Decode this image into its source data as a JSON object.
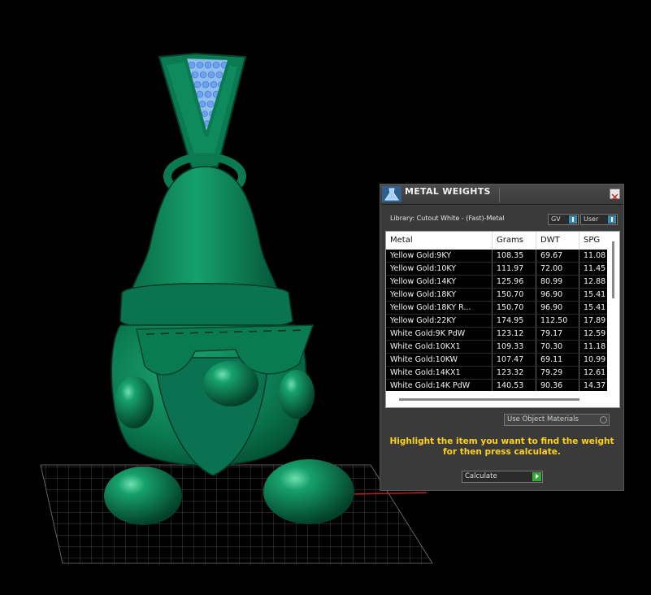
{
  "panel": {
    "title": "METAL WEIGHTS",
    "library": "Library: Cutout White - (Fast)-Metal",
    "gv_label": "GV",
    "user_label": "User",
    "columns": [
      "Metal",
      "Grams",
      "DWT",
      "SPG"
    ],
    "rows": [
      [
        "Yellow Gold:9KY",
        "108.35",
        "69.67",
        "11.08"
      ],
      [
        "Yellow Gold:10KY",
        "111.97",
        "72.00",
        "11.45"
      ],
      [
        "Yellow Gold:14KY",
        "125.96",
        "80.99",
        "12.88"
      ],
      [
        "Yellow Gold:18KY",
        "150.70",
        "96.90",
        "15.41"
      ],
      [
        "Yellow Gold:18KY R...",
        "150.70",
        "96.90",
        "15.41"
      ],
      [
        "Yellow Gold:22KY",
        "174.95",
        "112.50",
        "17.89"
      ],
      [
        "White Gold:9K PdW",
        "123.12",
        "79.17",
        "12.59"
      ],
      [
        "White Gold:10KX1",
        "109.33",
        "70.30",
        "11.18"
      ],
      [
        "White Gold:10KW",
        "107.47",
        "69.11",
        "10.99"
      ],
      [
        "White Gold:14KX1",
        "123.32",
        "79.29",
        "12.61"
      ],
      [
        "White Gold:14K PdW",
        "140.53",
        "90.36",
        "14.37"
      ]
    ],
    "use_object_materials": "Use Object Materials",
    "instruction": "Highlight the item you want to find the weight for then press calculate.",
    "calculate_label": "Calculate"
  },
  "colors": {
    "model_green": "#0a7a52",
    "gem_blue": "#8fb8ff",
    "instruction_yellow": "#ffd21a"
  }
}
